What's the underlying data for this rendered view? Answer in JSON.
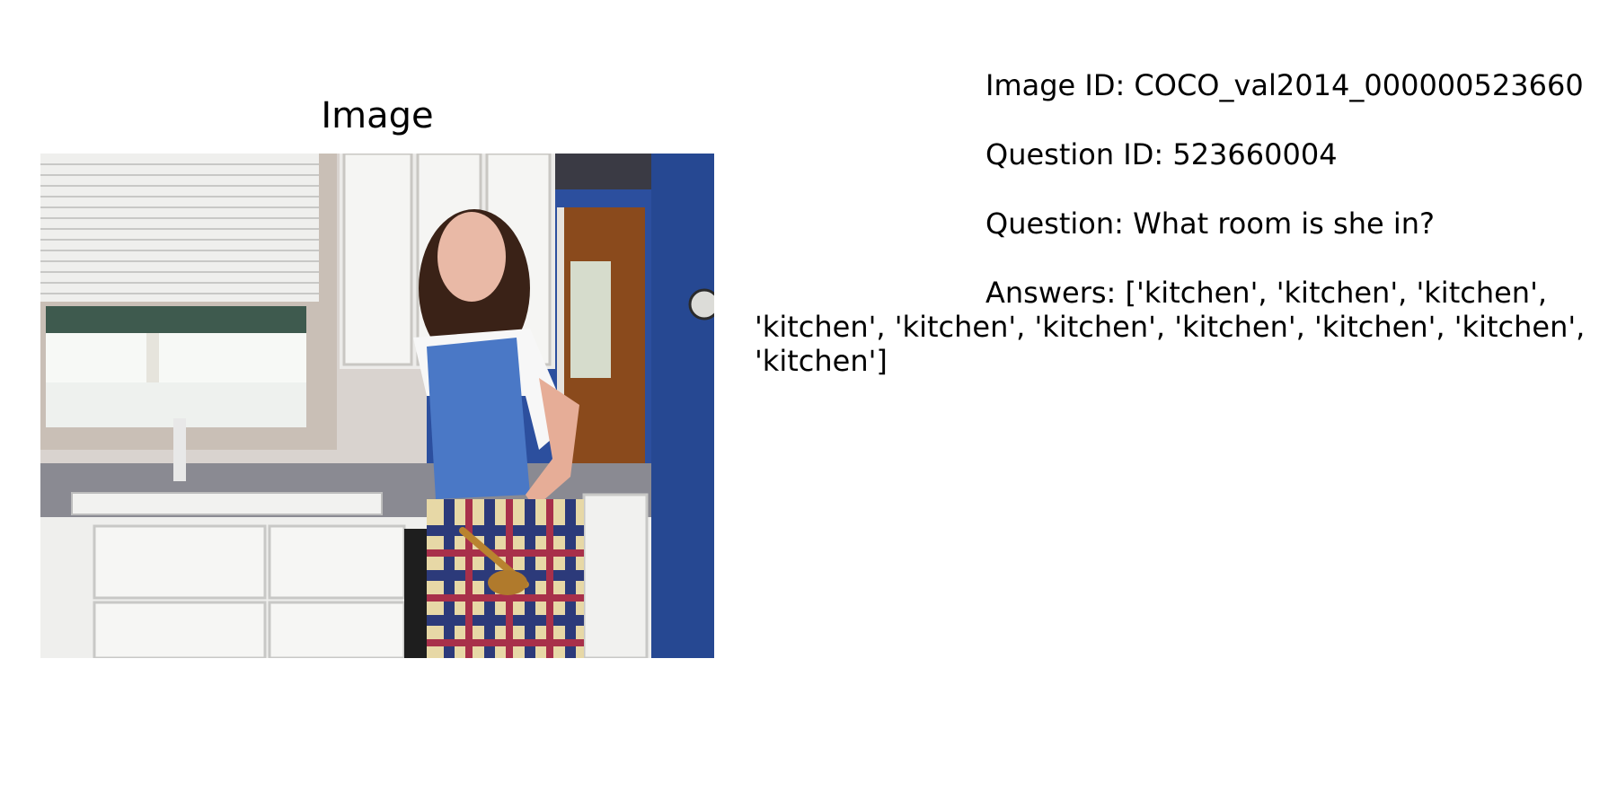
{
  "figure": {
    "title": "Image"
  },
  "details": {
    "image_id": "Image ID: COCO_val2014_000000523660",
    "question_id": "Question ID: 523660004",
    "question": "Question: What room is she in?",
    "answers": "Answers: ['kitchen', 'kitchen', 'kitchen', 'kitchen', 'kitchen', 'kitchen', 'kitchen', 'kitchen', 'kitchen', 'kitchen']"
  }
}
